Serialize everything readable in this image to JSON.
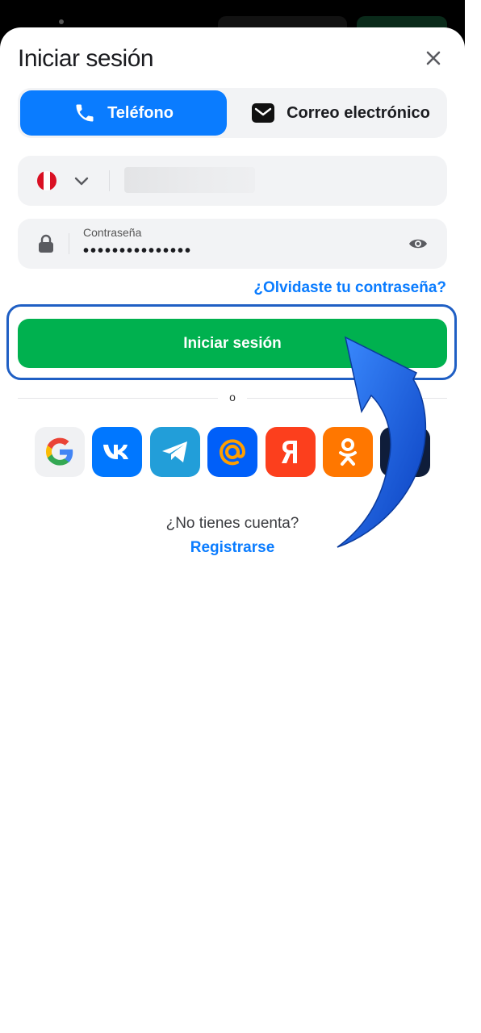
{
  "title": "Iniciar sesión",
  "tabs": [
    {
      "label": "Teléfono",
      "icon": "phone-icon",
      "active": true
    },
    {
      "label": "Correo electrónico",
      "icon": "envelope-icon",
      "active": false
    }
  ],
  "phone_field": {
    "country_flag": "flag-peru-icon",
    "value": ""
  },
  "password_field": {
    "label": "Contraseña",
    "masked_value": "•••••••••••••••"
  },
  "forgot_link": "¿Olvidaste tu contraseña?",
  "login_button": "Iniciar sesión",
  "divider_text": "o",
  "social_logins": [
    "google-icon",
    "vk-icon",
    "telegram-icon",
    "mail-ru-icon",
    "yandex-icon",
    "odnoklassniki-icon",
    "steam-icon"
  ],
  "no_account_text": "¿No tienes cuenta?",
  "register_link": "Registrarse",
  "colors": {
    "primary": "#0a7cff",
    "success": "#00b14f",
    "highlight": "#1f5fc4"
  }
}
